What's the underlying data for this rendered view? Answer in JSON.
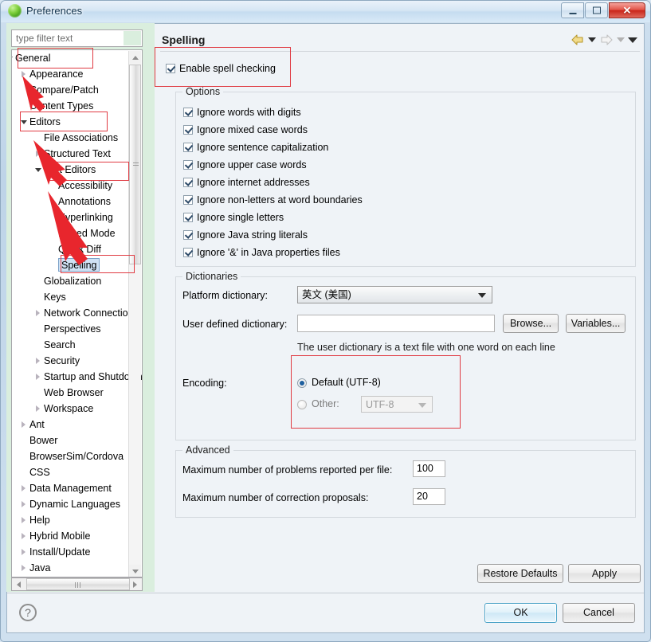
{
  "window": {
    "title": "Preferences",
    "icon": "eclipse-green-icon",
    "controls": {
      "minimize": "–",
      "maximize": "□",
      "close": "✕"
    }
  },
  "sidebar": {
    "filter": {
      "placeholder": "type filter text",
      "value": ""
    },
    "items": [
      {
        "label": "General",
        "indent": 0,
        "twisty": "down",
        "selected": false
      },
      {
        "label": "Appearance",
        "indent": 1,
        "twisty": "right",
        "selected": false
      },
      {
        "label": "Compare/Patch",
        "indent": 1,
        "twisty": "none",
        "selected": false
      },
      {
        "label": "Content Types",
        "indent": 1,
        "twisty": "none",
        "selected": false
      },
      {
        "label": "Editors",
        "indent": 1,
        "twisty": "down",
        "selected": false
      },
      {
        "label": "File Associations",
        "indent": 2,
        "twisty": "none",
        "selected": false
      },
      {
        "label": "Structured Text",
        "indent": 2,
        "twisty": "right",
        "selected": false
      },
      {
        "label": "Text Editors",
        "indent": 2,
        "twisty": "down",
        "selected": false
      },
      {
        "label": "Accessibility",
        "indent": 3,
        "twisty": "none",
        "selected": false
      },
      {
        "label": "Annotations",
        "indent": 3,
        "twisty": "none",
        "selected": false
      },
      {
        "label": "Hyperlinking",
        "indent": 3,
        "twisty": "none",
        "selected": false
      },
      {
        "label": "Linked Mode",
        "indent": 3,
        "twisty": "none",
        "selected": false
      },
      {
        "label": "Quick Diff",
        "indent": 3,
        "twisty": "none",
        "selected": false
      },
      {
        "label": "Spelling",
        "indent": 3,
        "twisty": "none",
        "selected": true
      },
      {
        "label": "Globalization",
        "indent": 2,
        "twisty": "none",
        "selected": false
      },
      {
        "label": "Keys",
        "indent": 2,
        "twisty": "none",
        "selected": false
      },
      {
        "label": "Network Connections",
        "indent": 2,
        "twisty": "right",
        "selected": false
      },
      {
        "label": "Perspectives",
        "indent": 2,
        "twisty": "none",
        "selected": false
      },
      {
        "label": "Search",
        "indent": 2,
        "twisty": "none",
        "selected": false
      },
      {
        "label": "Security",
        "indent": 2,
        "twisty": "right",
        "selected": false
      },
      {
        "label": "Startup and Shutdown",
        "indent": 2,
        "twisty": "right",
        "selected": false
      },
      {
        "label": "Web Browser",
        "indent": 2,
        "twisty": "none",
        "selected": false
      },
      {
        "label": "Workspace",
        "indent": 2,
        "twisty": "right",
        "selected": false
      },
      {
        "label": "Ant",
        "indent": 1,
        "twisty": "right",
        "selected": false
      },
      {
        "label": "Bower",
        "indent": 1,
        "twisty": "none",
        "selected": false
      },
      {
        "label": "BrowserSim/Cordova",
        "indent": 1,
        "twisty": "none",
        "selected": false
      },
      {
        "label": "CSS",
        "indent": 1,
        "twisty": "none",
        "selected": false
      },
      {
        "label": "Data Management",
        "indent": 1,
        "twisty": "right",
        "selected": false
      },
      {
        "label": "Dynamic Languages",
        "indent": 1,
        "twisty": "right",
        "selected": false
      },
      {
        "label": "Help",
        "indent": 1,
        "twisty": "right",
        "selected": false
      },
      {
        "label": "Hybrid Mobile",
        "indent": 1,
        "twisty": "right",
        "selected": false
      },
      {
        "label": "Install/Update",
        "indent": 1,
        "twisty": "right",
        "selected": false
      },
      {
        "label": "Java",
        "indent": 1,
        "twisty": "right",
        "selected": false
      }
    ]
  },
  "main": {
    "title": "Spelling",
    "nav": {
      "back": "back-arrow",
      "forward": "forward-arrow",
      "menu": "dropdown-caret"
    },
    "enable_spell_checking": {
      "label": "Enable spell checking",
      "checked": true
    },
    "options": {
      "title": "Options",
      "items": [
        {
          "label": "Ignore words with digits",
          "checked": true
        },
        {
          "label": "Ignore mixed case words",
          "checked": true
        },
        {
          "label": "Ignore sentence capitalization",
          "checked": true
        },
        {
          "label": "Ignore upper case words",
          "checked": true
        },
        {
          "label": "Ignore internet addresses",
          "checked": true
        },
        {
          "label": "Ignore non-letters at word boundaries",
          "checked": true
        },
        {
          "label": "Ignore single letters",
          "checked": true
        },
        {
          "label": "Ignore Java string literals",
          "checked": true
        },
        {
          "label": "Ignore '&' in Java properties files",
          "checked": true
        }
      ]
    },
    "dictionaries": {
      "title": "Dictionaries",
      "platform_label": "Platform dictionary:",
      "platform_value": "英文 (美国)",
      "user_label": "User defined dictionary:",
      "user_value": "",
      "browse_button": "Browse...",
      "variables_button": "Variables...",
      "hint": "The user dictionary is a text file with one word on each line",
      "encoding_label": "Encoding:",
      "encoding_default": {
        "label": "Default (UTF-8)",
        "selected": true
      },
      "encoding_other": {
        "label": "Other:",
        "selected": false,
        "value": "UTF-8",
        "disabled": true
      }
    },
    "advanced": {
      "title": "Advanced",
      "max_problems_label": "Maximum number of problems reported per file:",
      "max_problems_value": "100",
      "max_proposals_label": "Maximum number of correction proposals:",
      "max_proposals_value": "20"
    },
    "restore_defaults_button": "Restore Defaults",
    "apply_button": "Apply"
  },
  "footer": {
    "help_icon": "question-mark-icon",
    "ok_button": "OK",
    "cancel_button": "Cancel"
  },
  "annotations": {
    "accent_color": "#e03b43",
    "boxes": [
      {
        "name": "general-node-box"
      },
      {
        "name": "editors-node-box"
      },
      {
        "name": "text-editors-node-box"
      },
      {
        "name": "spelling-node-box"
      },
      {
        "name": "enable-spell-checking-box"
      },
      {
        "name": "encoding-box"
      }
    ],
    "arrows": [
      {
        "name": "arrow-to-editors"
      },
      {
        "name": "arrow-to-text-editors"
      },
      {
        "name": "arrow-to-spelling"
      }
    ]
  }
}
